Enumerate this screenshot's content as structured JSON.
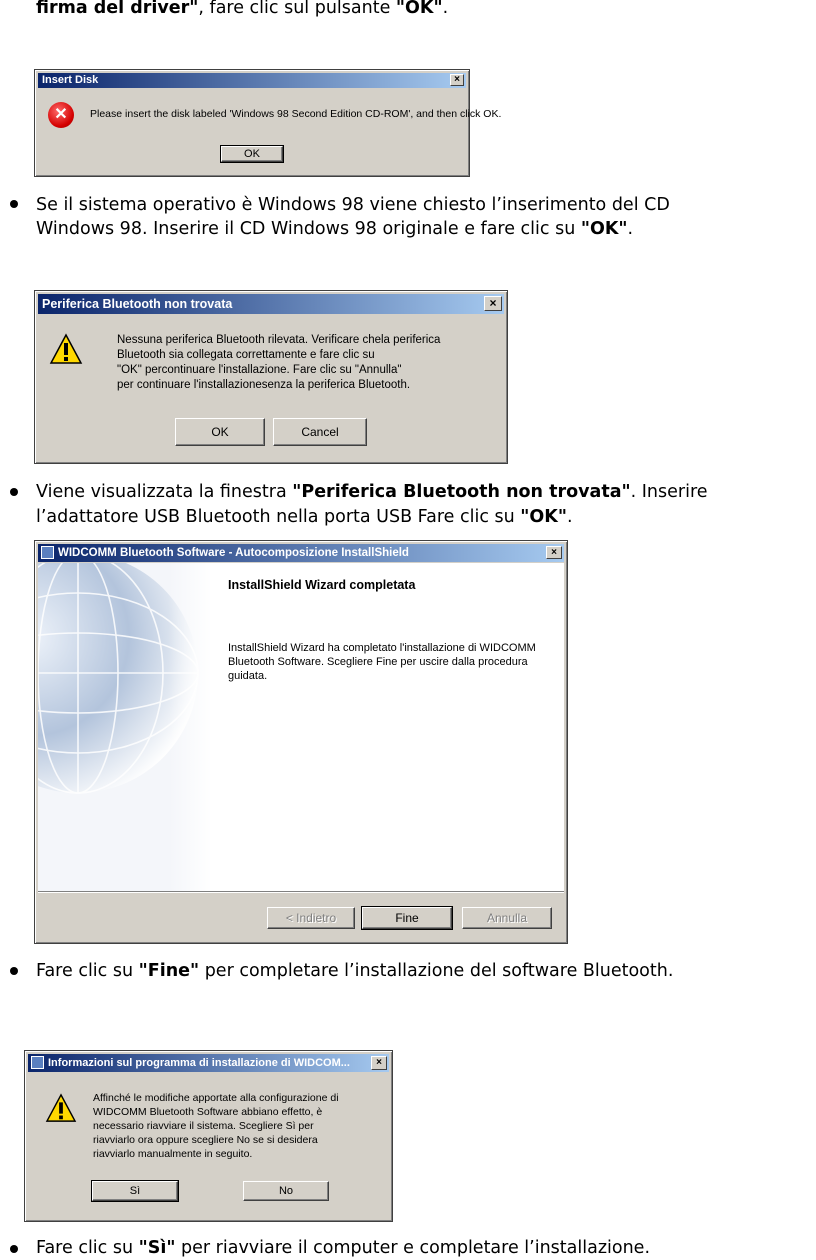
{
  "intro": {
    "bold1": "firma del driver\"",
    "text1": ", fare clic sul pulsante ",
    "bold2": "\"OK\"",
    "text2": "."
  },
  "dialog_insert_disk": {
    "title": "Insert Disk",
    "close": "×",
    "icon": "error-icon",
    "message": "Please insert the disk labeled 'Windows 98 Second Edition CD-ROM', and then click OK.",
    "ok_label": "OK"
  },
  "bullet1": {
    "line1": "Se il sistema operativo è Windows 98 viene chiesto l’inserimento del CD",
    "line2_text": "Windows 98. Inserire il CD Windows 98 originale e fare clic su ",
    "line2_bold": "\"OK\"",
    "line2_end": "."
  },
  "dialog_bt_not_found": {
    "title": "Periferica Bluetooth non trovata",
    "close": "×",
    "icon": "warning-icon",
    "message_lines": [
      "Nessuna periferica Bluetooth rilevata. Verificare chela periferica",
      "Bluetooth sia collegata correttamente e fare clic su",
      "\"OK\" percontinuare l'installazione. Fare clic su \"Annulla\"",
      "per continuare l'installazionesenza la periferica Bluetooth."
    ],
    "ok_label": "OK",
    "cancel_label": "Cancel"
  },
  "bullet2": {
    "text1": "Viene visualizzata la finestra ",
    "bold1": "\"Periferica Bluetooth non trovata\"",
    "text2": ". Inserire",
    "line2_text": "l’adattatore USB Bluetooth nella porta USB Fare clic su ",
    "line2_bold": "\"OK\"",
    "line2_end": "."
  },
  "dialog_wizard": {
    "title": "WIDCOMM Bluetooth Software - Autocomposizione InstallShield",
    "close": "×",
    "heading": "InstallShield Wizard completata",
    "body_lines": [
      "InstallShield Wizard ha completato l'installazione di WIDCOMM",
      "Bluetooth Software. Scegliere Fine per uscire dalla procedura",
      "guidata."
    ],
    "back_label": "< Indietro",
    "finish_label": "Fine",
    "cancel_label": "Annulla"
  },
  "bullet3": {
    "text1": "Fare clic su ",
    "bold1": "\"Fine\"",
    "text2": " per completare l’installazione del software Bluetooth."
  },
  "dialog_restart": {
    "title": "Informazioni sul programma di installazione di WIDCOM...",
    "close": "×",
    "icon": "warning-icon",
    "message_lines": [
      "Affinché le modifiche apportate alla configurazione di",
      "WIDCOMM Bluetooth Software abbiano effetto, è",
      "necessario riavviare il sistema. Scegliere Sì per",
      "riavviarlo ora oppure scegliere No se si desidera",
      "riavviarlo manualmente in seguito."
    ],
    "yes_label": "Sì",
    "no_label": "No"
  },
  "bullet4": {
    "text1": "Fare clic su ",
    "bold1": "\"Sì\"",
    "text2": " per riavviare il computer e completare l’installazione."
  },
  "colors": {
    "titlebar_start": "#0a246a",
    "titlebar_end": "#a6caf0",
    "dialog_face": "#d4d0c8"
  }
}
